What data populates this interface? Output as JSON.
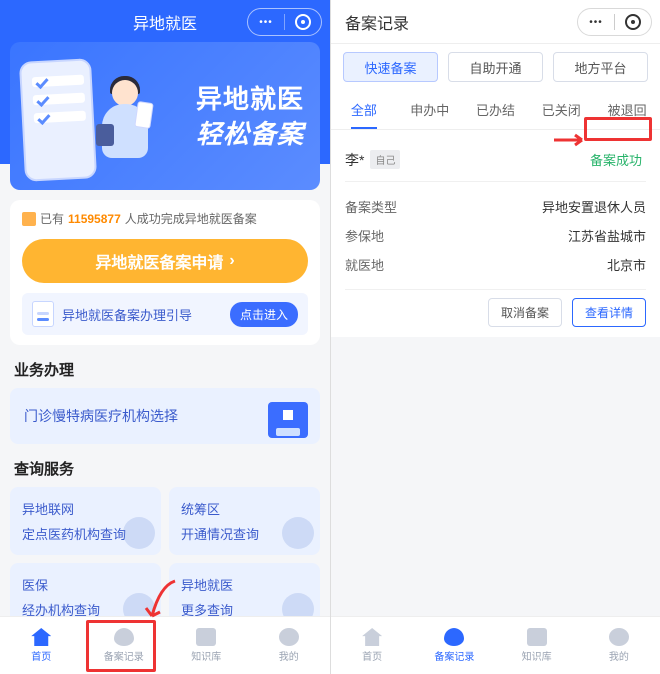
{
  "left": {
    "header": {
      "title": "异地就医"
    },
    "hero": {
      "line1": "异地就医",
      "line2": "轻松备案"
    },
    "stats": {
      "prefix": "已有",
      "count": "11595877",
      "suffix": "人成功完成异地就医备案"
    },
    "cta_label": "异地就医备案申请",
    "guide": {
      "text": "异地就医备案办理引导",
      "btn": "点击进入"
    },
    "sect_biz": "业务办理",
    "biz_card": "门诊慢特病医疗机构选择",
    "sect_query": "查询服务",
    "q": [
      {
        "l1": "异地联网",
        "l2": "定点医药机构查询"
      },
      {
        "l1": "统筹区",
        "l2": "开通情况查询"
      },
      {
        "l1": "医保",
        "l2": "经办机构查询"
      },
      {
        "l1": "异地就医",
        "l2": "更多查询"
      }
    ],
    "tabs": [
      "首页",
      "备案记录",
      "知识库",
      "我的"
    ]
  },
  "right": {
    "header": {
      "title": "备案记录"
    },
    "chips": [
      "快速备案",
      "自助开通",
      "地方平台"
    ],
    "status_tabs": [
      "全部",
      "申办中",
      "已办结",
      "已关闭",
      "被退回"
    ],
    "record": {
      "name": "李*",
      "self_tag": "自己",
      "status": "备案成功",
      "rows": [
        {
          "k": "备案类型",
          "v": "异地安置退休人员"
        },
        {
          "k": "参保地",
          "v": "江苏省盐城市"
        },
        {
          "k": "就医地",
          "v": "北京市"
        }
      ],
      "actions": {
        "cancel": "取消备案",
        "detail": "查看详情"
      }
    },
    "tabs": [
      "首页",
      "备案记录",
      "知识库",
      "我的"
    ]
  }
}
